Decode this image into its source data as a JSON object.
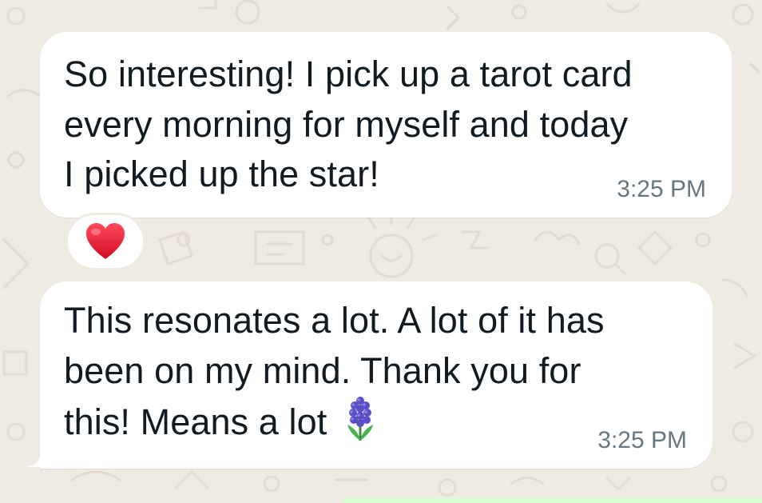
{
  "messages": [
    {
      "lines": [
        "So interesting! I pick up a tarot card",
        "every morning for myself and today",
        "I picked up the star!"
      ],
      "time": "3:25 PM",
      "reaction": "heart-emoji"
    },
    {
      "lines": [
        "This resonates a lot. A lot of it has",
        "been on my mind. Thank you for",
        "this! Means a lot"
      ],
      "emoji": "hyacinth-emoji",
      "time": "3:25 PM"
    }
  ],
  "colors": {
    "wallpaper": "#efeae2",
    "bubble": "#ffffff",
    "text": "#111b21",
    "timestamp": "#667781",
    "heart": "#e8112d",
    "hyacinth": "#5b4fc8"
  }
}
